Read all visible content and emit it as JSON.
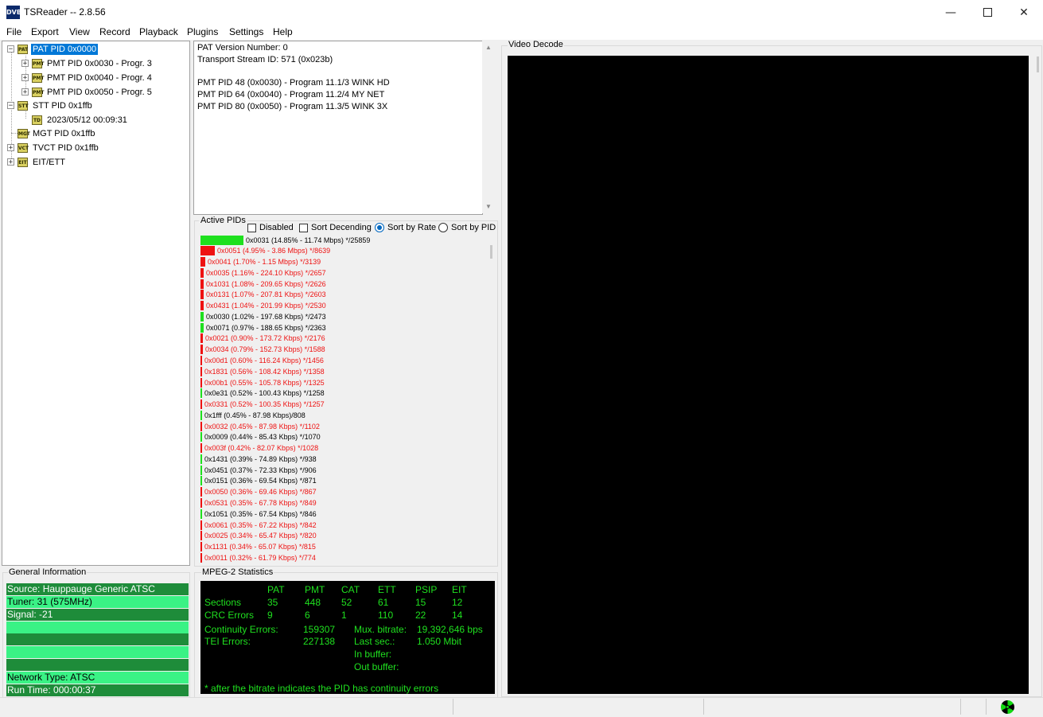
{
  "window": {
    "title": "TSReader -- 2.8.56",
    "app_icon": "DVB",
    "controls": [
      "minimize-icon",
      "maximize-icon",
      "close-icon"
    ]
  },
  "menu": [
    "File",
    "Export",
    "View",
    "Record",
    "Playback",
    "Plugins",
    "Settings",
    "Help"
  ],
  "tree": {
    "pat": {
      "label": "PAT PID 0x0000",
      "icon": "PAT"
    },
    "programs": [
      {
        "label": "PMT PID 0x0030 - Progr. 3",
        "icon": "PMT"
      },
      {
        "label": "PMT PID 0x0040 - Progr. 4",
        "icon": "PMT"
      },
      {
        "label": "PMT PID 0x0050 - Progr. 5",
        "icon": "PMT"
      }
    ],
    "stt": {
      "label": "STT PID 0x1ffb",
      "icon": "STT"
    },
    "stt_time": {
      "label": "2023/05/12 00:09:31",
      "icon": "TD"
    },
    "mgt": {
      "label": "MGT PID 0x1ffb",
      "icon": "MGT"
    },
    "tvct": {
      "label": "TVCT PID 0x1ffb",
      "icon": "VCT"
    },
    "eit": {
      "label": "EIT/ETT",
      "icon": "EIT"
    }
  },
  "pat_info": [
    "PAT Version Number: 0",
    "Transport Stream ID: 571 (0x023b)",
    "",
    "PMT PID 48 (0x0030) - Program 11.1/3 WINK HD",
    "PMT PID 64 (0x0040) - Program 11.2/4 MY NET",
    "PMT PID 80 (0x0050) - Program 11.3/5 WINK 3X"
  ],
  "active_pids": {
    "legend": "Active PIDs",
    "disabled_label": "Disabled",
    "sort_desc_label": "Sort Decending",
    "sort_rate_label": "Sort by Rate",
    "sort_pid_label": "Sort by PID",
    "sort_mode": "rate",
    "colors": {
      "ok": "#1ee01e",
      "error": "#ee1111"
    },
    "rows": [
      {
        "text": "0x0031 (14.85% - 11.74 Mbps) */25859",
        "pct": 14.85,
        "err": false
      },
      {
        "text": "0x0051 (4.95% - 3.86 Mbps) */8639",
        "pct": 4.95,
        "err": true
      },
      {
        "text": "0x0041 (1.70% - 1.15 Mbps) */3139",
        "pct": 1.7,
        "err": true
      },
      {
        "text": "0x0035 (1.16% - 224.10 Kbps) */2657",
        "pct": 1.16,
        "err": true
      },
      {
        "text": "0x1031 (1.08% - 209.65 Kbps) */2626",
        "pct": 1.08,
        "err": true
      },
      {
        "text": "0x0131 (1.07% - 207.81 Kbps) */2603",
        "pct": 1.07,
        "err": true
      },
      {
        "text": "0x0431 (1.04% - 201.99 Kbps) */2530",
        "pct": 1.04,
        "err": true
      },
      {
        "text": "0x0030 (1.02% - 197.68 Kbps) */2473",
        "pct": 1.02,
        "err": false
      },
      {
        "text": "0x0071 (0.97% - 188.65 Kbps) */2363",
        "pct": 0.97,
        "err": false
      },
      {
        "text": "0x0021 (0.90% - 173.72 Kbps) */2176",
        "pct": 0.9,
        "err": true
      },
      {
        "text": "0x0034 (0.79% - 152.73 Kbps) */1588",
        "pct": 0.79,
        "err": true
      },
      {
        "text": "0x00d1 (0.60% - 116.24 Kbps) */1456",
        "pct": 0.6,
        "err": true
      },
      {
        "text": "0x1831 (0.56% - 108.42 Kbps) */1358",
        "pct": 0.56,
        "err": true
      },
      {
        "text": "0x00b1 (0.55% - 105.78 Kbps) */1325",
        "pct": 0.55,
        "err": true
      },
      {
        "text": "0x0e31 (0.52% - 100.43 Kbps) */1258",
        "pct": 0.52,
        "err": false
      },
      {
        "text": "0x0331 (0.52% - 100.35 Kbps) */1257",
        "pct": 0.52,
        "err": true
      },
      {
        "text": "0x1fff (0.45% - 87.98 Kbps)/808",
        "pct": 0.45,
        "err": false
      },
      {
        "text": "0x0032 (0.45% - 87.98 Kbps) */1102",
        "pct": 0.45,
        "err": true
      },
      {
        "text": "0x0009 (0.44% - 85.43 Kbps) */1070",
        "pct": 0.44,
        "err": false
      },
      {
        "text": "0x003f (0.42% - 82.07 Kbps) */1028",
        "pct": 0.42,
        "err": true
      },
      {
        "text": "0x1431 (0.39% - 74.89 Kbps) */938",
        "pct": 0.39,
        "err": false
      },
      {
        "text": "0x0451 (0.37% - 72.33 Kbps) */906",
        "pct": 0.37,
        "err": false
      },
      {
        "text": "0x0151 (0.36% - 69.54 Kbps) */871",
        "pct": 0.36,
        "err": false
      },
      {
        "text": "0x0050 (0.36% - 69.46 Kbps) */867",
        "pct": 0.36,
        "err": true
      },
      {
        "text": "0x0531 (0.35% - 67.78 Kbps) */849",
        "pct": 0.35,
        "err": true
      },
      {
        "text": "0x1051 (0.35% - 67.54 Kbps) */846",
        "pct": 0.35,
        "err": false
      },
      {
        "text": "0x0061 (0.35% - 67.22 Kbps) */842",
        "pct": 0.35,
        "err": true
      },
      {
        "text": "0x0025 (0.34% - 65.47 Kbps) */820",
        "pct": 0.34,
        "err": true
      },
      {
        "text": "0x1131 (0.34% - 65.07 Kbps) */815",
        "pct": 0.34,
        "err": true
      },
      {
        "text": "0x0011 (0.32% - 61.79 Kbps) */774",
        "pct": 0.32,
        "err": true
      }
    ]
  },
  "general_info": {
    "legend": "General Information",
    "source": "Source: Hauppauge Generic ATSC",
    "tuner": "Tuner: 31 (575MHz)",
    "signal": "Signal: -21",
    "network": "Network Type: ATSC",
    "runtime": "Run Time: 000:00:37"
  },
  "mpeg2_stats": {
    "legend": "MPEG-2 Statistics",
    "headers": [
      "PAT",
      "PMT",
      "CAT",
      "ETT",
      "PSIP",
      "EIT"
    ],
    "sections_label": "Sections",
    "sections": [
      "35",
      "448",
      "52",
      "61",
      "15",
      "12"
    ],
    "crc_label": "CRC Errors",
    "crc": [
      "9",
      "6",
      "1",
      "110",
      "22",
      "14"
    ],
    "continuity_label": "Continuity Errors:",
    "continuity_value": "159307",
    "tei_label": "TEI Errors:",
    "tei_value": "227138",
    "mux_label": "Mux. bitrate:",
    "mux_value": "19,392,646 bps",
    "last_label": "Last sec.:",
    "last_value": "1.050 Mbit",
    "in_label": "In buffer:",
    "out_label": "Out buffer:",
    "footnote": "* after the bitrate indicates the PID has continuity errors"
  },
  "video": {
    "legend": "Video Decode"
  },
  "status": {
    "icon": "radiation-icon"
  }
}
